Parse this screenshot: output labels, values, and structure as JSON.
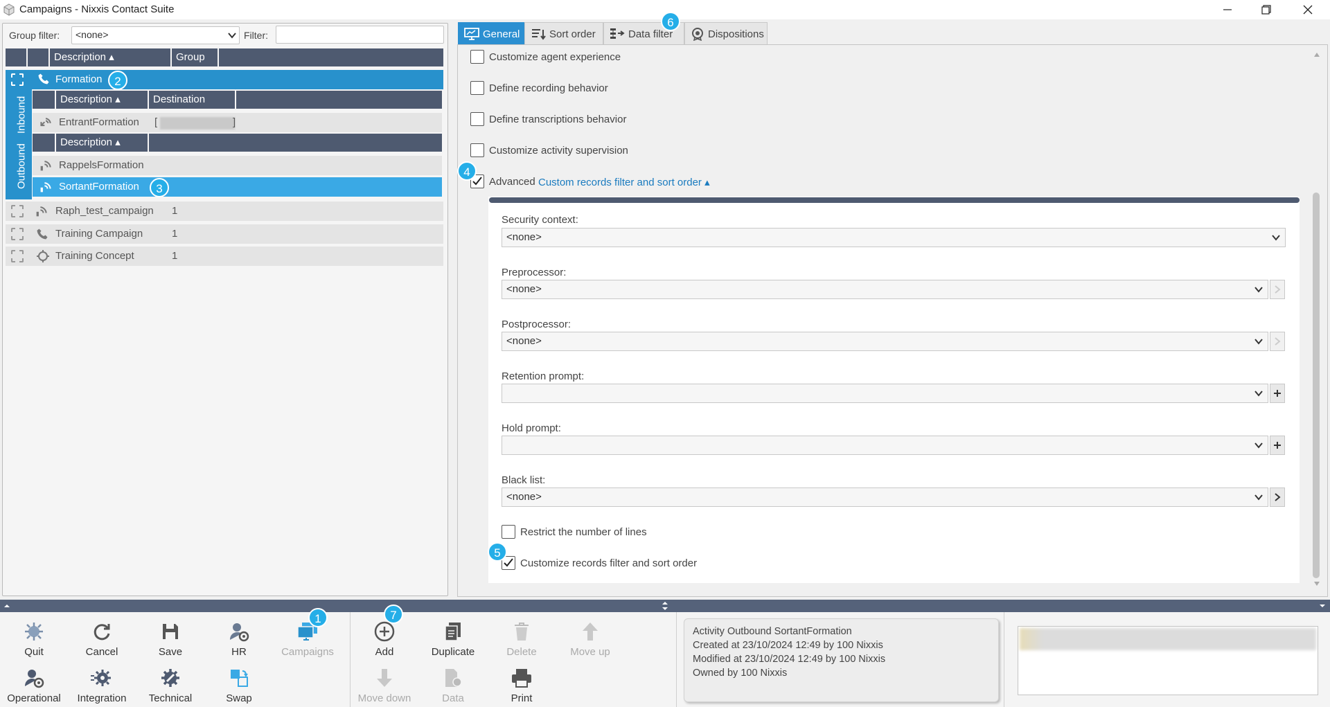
{
  "window": {
    "title": "Campaigns - Nixxis Contact Suite"
  },
  "left": {
    "group_filter_label": "Group filter:",
    "group_filter_value": "<none>",
    "filter_label": "Filter:",
    "filter_value": "",
    "columns": [
      "Description",
      "Group"
    ],
    "inbound_tab": "Inbound",
    "outbound_tab": "Outbound",
    "selected_campaign": "Formation",
    "inbound_columns": [
      "Description",
      "Destination"
    ],
    "inbound_rows": [
      {
        "description": "EntrantFormation",
        "destination": "[",
        "destination_end": "]"
      }
    ],
    "outbound_columns": [
      "Description"
    ],
    "outbound_rows": [
      {
        "description": "RappelsFormation"
      },
      {
        "description": "SortantFormation"
      }
    ],
    "campaigns": [
      {
        "description": "Raph_test_campaign",
        "group": "1",
        "icon": "outbound-dialer-icon"
      },
      {
        "description": "Training Campaign",
        "group": "1",
        "icon": "phone-icon"
      },
      {
        "description": "Training Concept",
        "group": "1",
        "icon": "crosshair-icon"
      }
    ]
  },
  "tabs": [
    {
      "label": "General",
      "icon": "monitor-icon",
      "active": true
    },
    {
      "label": "Sort order",
      "icon": "sort-icon"
    },
    {
      "label": "Data filter",
      "icon": "data-filter-icon"
    },
    {
      "label": "Dispositions",
      "icon": "badge-icon"
    }
  ],
  "general": {
    "checkboxes": [
      {
        "label": "Customize agent experience",
        "checked": false
      },
      {
        "label": "Define recording behavior",
        "checked": false
      },
      {
        "label": "Define transcriptions behavior",
        "checked": false
      },
      {
        "label": "Customize activity supervision",
        "checked": false
      }
    ],
    "advanced_label": "Advanced",
    "advanced_link": "Custom records filter and sort order",
    "advanced_checked": true,
    "fields": {
      "security_context": {
        "label": "Security context:",
        "value": "<none>"
      },
      "preprocessor": {
        "label": "Preprocessor:",
        "value": "<none>"
      },
      "postprocessor": {
        "label": "Postprocessor:",
        "value": "<none>"
      },
      "retention_prompt": {
        "label": "Retention prompt:",
        "value": ""
      },
      "hold_prompt": {
        "label": "Hold prompt:",
        "value": ""
      },
      "black_list": {
        "label": "Black list:",
        "value": "<none>"
      }
    },
    "restrict_lines": {
      "label": "Restrict the number of lines",
      "checked": false
    },
    "customize_records": {
      "label": "Customize records filter and sort order",
      "checked": true
    }
  },
  "toolbar": {
    "group1": [
      {
        "label": "Quit",
        "icon": "quit-icon"
      },
      {
        "label": "Cancel",
        "icon": "refresh-icon"
      },
      {
        "label": "Save",
        "icon": "save-icon"
      },
      {
        "label": "HR",
        "icon": "hr-icon"
      },
      {
        "label": "Campaigns",
        "icon": "campaigns-icon",
        "disabled": true
      },
      {
        "label": "Operational",
        "icon": "operational-icon"
      },
      {
        "label": "Integration",
        "icon": "integration-icon"
      },
      {
        "label": "Technical",
        "icon": "technical-icon"
      },
      {
        "label": "Swap",
        "icon": "swap-icon"
      }
    ],
    "group2": [
      {
        "label": "Add",
        "icon": "add-icon"
      },
      {
        "label": "Duplicate",
        "icon": "duplicate-icon"
      },
      {
        "label": "Delete",
        "icon": "delete-icon",
        "disabled": true
      },
      {
        "label": "Move up",
        "icon": "move-up-icon",
        "disabled": true
      },
      {
        "label": "Move down",
        "icon": "move-down-icon",
        "disabled": true
      },
      {
        "label": "Data",
        "icon": "data-icon",
        "disabled": true
      },
      {
        "label": "Print",
        "icon": "print-icon"
      }
    ]
  },
  "info": {
    "line1": "Activity Outbound SortantFormation",
    "line2": "Created at 23/10/2024 12:49 by 100 Nixxis",
    "line3": "Modified at 23/10/2024 12:49 by 100 Nixxis",
    "line4": "Owned by 100 Nixxis"
  },
  "annotations": [
    "1",
    "2",
    "3",
    "4",
    "5",
    "6",
    "7"
  ],
  "colors": {
    "accent": "#2891cc",
    "header": "#4e5a70",
    "badge": "#25aee8"
  }
}
